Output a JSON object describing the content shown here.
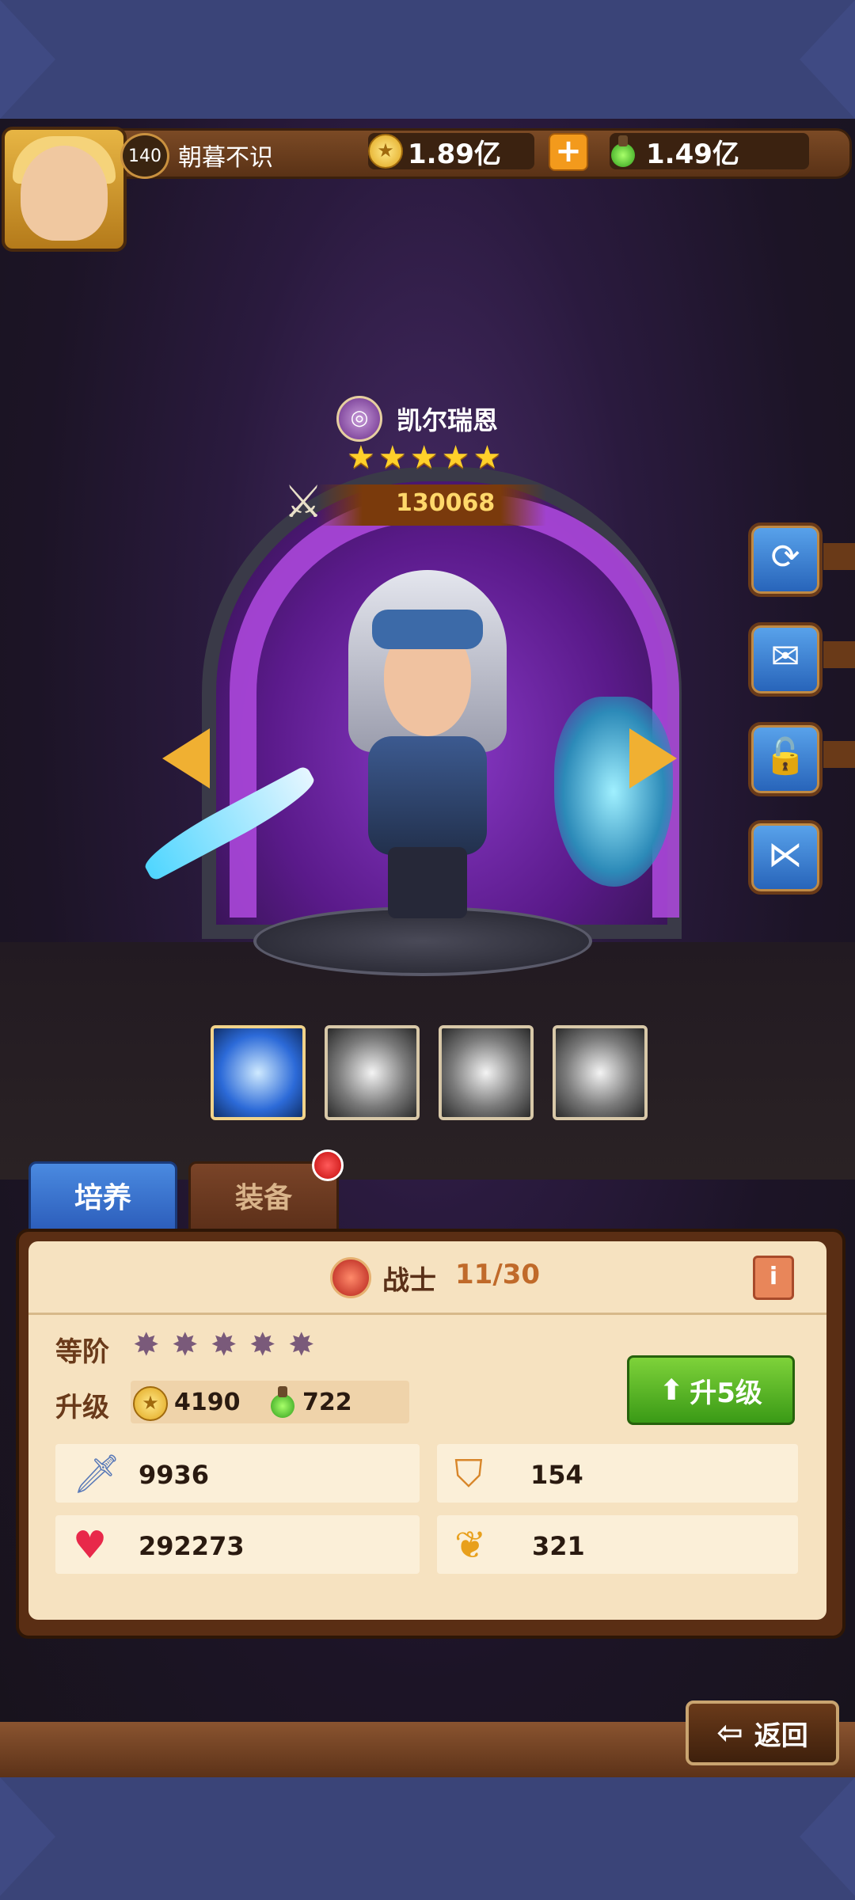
{
  "player": {
    "level": "140",
    "name": "朝暮不识",
    "gold": "1.89亿",
    "potion": "1.49亿"
  },
  "hero": {
    "name": "凯尔瑞恩",
    "stars": 5,
    "power": "130068"
  },
  "side_buttons": [
    "refresh-icon",
    "chat-icon",
    "lock-icon",
    "share-icon"
  ],
  "skills": [
    "skill-1",
    "skill-2",
    "skill-3",
    "skill-4"
  ],
  "tabs": {
    "train": "培养",
    "equip": "装备"
  },
  "panel": {
    "class_label": "战士",
    "class_count": "11/30",
    "info_label": "i",
    "rank_label": "等阶",
    "rank_stars": 5,
    "upgrade_label": "升级",
    "upgrade_gold": "4190",
    "upgrade_potion": "722",
    "upgrade_button": "升5级",
    "stats": {
      "attack": "9936",
      "defense": "154",
      "hp": "292273",
      "speed": "321"
    }
  },
  "back_label": "返回",
  "colors": {
    "accent_blue": "#2a5ab8",
    "gold": "#ffd02a",
    "green_button": "#3a9a16",
    "panel_bg": "#f6e2c0"
  }
}
